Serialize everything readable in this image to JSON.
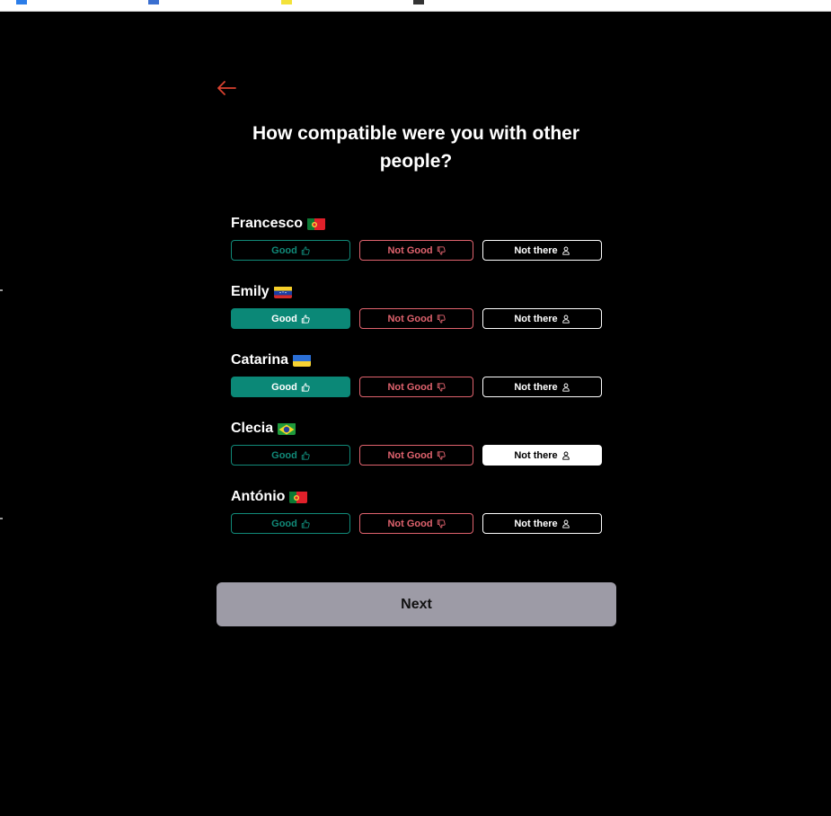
{
  "title": "How compatible were you with other people?",
  "colors": {
    "accent_red": "#d9412f",
    "good": "#0b8877",
    "not_good": "#e0636e",
    "next_bg": "#9d9ba6"
  },
  "labels": {
    "good": "Good",
    "not_good": "Not Good",
    "not_there": "Not there",
    "next": "Next"
  },
  "icons": {
    "back": "arrow-left-icon",
    "good": "thumbs-up-icon",
    "not_good": "thumbs-down-icon",
    "not_there": "person-icon"
  },
  "people": [
    {
      "name": "Francesco",
      "flag": "portugal",
      "selected": "none"
    },
    {
      "name": "Emily",
      "flag": "venezuela",
      "selected": "good"
    },
    {
      "name": "Catarina",
      "flag": "ukraine",
      "selected": "good"
    },
    {
      "name": "Clecia",
      "flag": "brazil",
      "selected": "not_there"
    },
    {
      "name": "António",
      "flag": "portugal",
      "selected": "none"
    }
  ]
}
